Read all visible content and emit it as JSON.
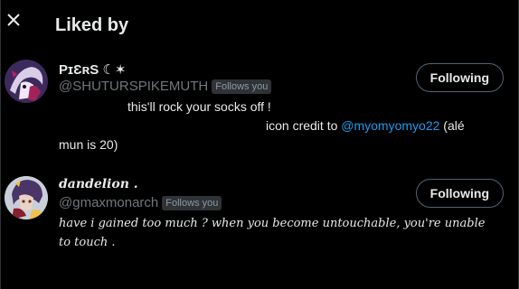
{
  "header": {
    "title": "Liked by"
  },
  "users": [
    {
      "display_name": "PɪƐʀS ☾✶",
      "handle": "@SHUTURSPIKEMUTH",
      "follows_you": "Follows you",
      "follow_state": "Following",
      "bio_line1": "this'll rock your socks off !",
      "bio_line2_prefix": "icon credit to ",
      "bio_mention": "@myomyomyo22",
      "bio_line2_suffix": " (alé",
      "bio_line3": "mun is 20)"
    },
    {
      "display_name": "dandelion .",
      "handle": "@gmaxmonarch",
      "follows_you": "Follows you",
      "follow_state": "Following",
      "bio_line1": "have i gained too much ? when you become untouchable, you're unable",
      "bio_line2": "to touch ."
    }
  ],
  "colors": {
    "background": "#000000",
    "text": "#e7e9ea",
    "muted": "#71767b",
    "accent": "#1d9bf0"
  }
}
